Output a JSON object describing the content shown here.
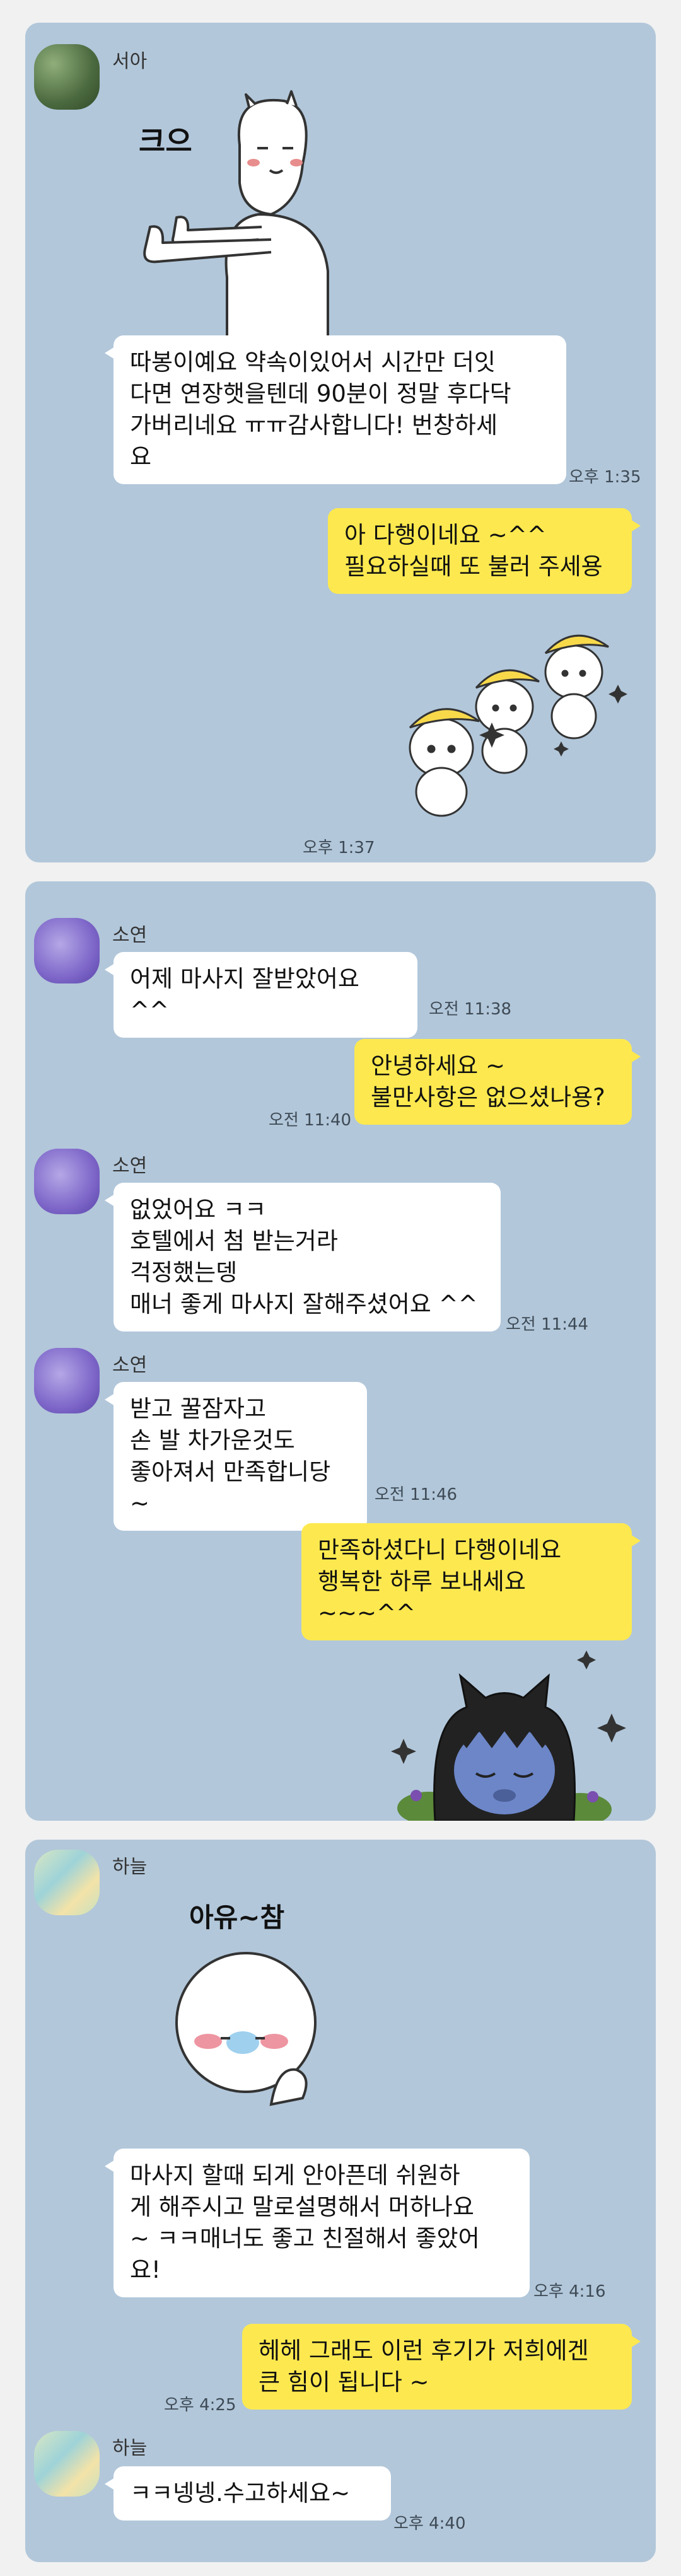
{
  "colors": {
    "chat_background": "#b2c7da",
    "page_background": "#f1f1f1",
    "incoming_bubble": "#ffffff",
    "outgoing_bubble": "#fde94f",
    "timestamp_text": "#3e4a55"
  },
  "chat1": {
    "sender": "서아",
    "sticker1_caption": "크으",
    "sticker1_icon": "thumbs-up-character-sticker",
    "msg1": "따봉이예요 약속이있어서 시간만 더잇\n다면 연장햇을텐데 90분이 정말 후다닥\n가버리네요 ㅠㅠ감사합니다! 번창하세\n요",
    "msg1_time": "오후 1:35",
    "reply1": "아 다행이네요 ~^^\n필요하실때 또 불러 주세용",
    "sticker2_icon": "dancing-banana-hat-bunnies-sticker",
    "reply_time": "오후 1:37"
  },
  "chat2": {
    "sender": "소연",
    "msg1": "어제 마사지 잘받았어요 ^^",
    "msg1_time": "오전 11:38",
    "reply1": "안녕하세요 ~\n불만사항은 없으셨나용?",
    "reply1_time": "오전 11:40",
    "msg2": "없었어요 ㅋㅋ\n호텔에서 첨 받는거라\n걱정했는뎅\n매너 좋게 마사지 잘해주셨어요 ^^",
    "msg2_time": "오전 11:44",
    "msg3": "받고 꿀잠자고\n손 발 차가운것도\n좋아져서 만족합니당 ~",
    "msg3_time": "오전 11:46",
    "reply2": "만족하셨다니 다행이네요\n행복한 하루 보내세요 ~~~^^",
    "sticker_icon": "sleeping-cat-sticker"
  },
  "chat3": {
    "sender": "하늘",
    "sticker_caption": "아유~참",
    "sticker_icon": "blushing-round-face-sticker",
    "msg1": "마사지 할때 되게 안아픈데 쉬원하\n게 해주시고 말로설명해서 머하나요\n~ ㅋㅋ매너도 좋고 친절해서 좋았어\n요!",
    "msg1_time": "오후 4:16",
    "reply1": "헤헤 그래도 이런 후기가 저희에겐\n큰 힘이 됩니다 ~",
    "reply1_time": "오후 4:25",
    "msg2": "ㅋㅋ넹넹.수고하세요~",
    "msg2_time": "오후 4:40"
  }
}
